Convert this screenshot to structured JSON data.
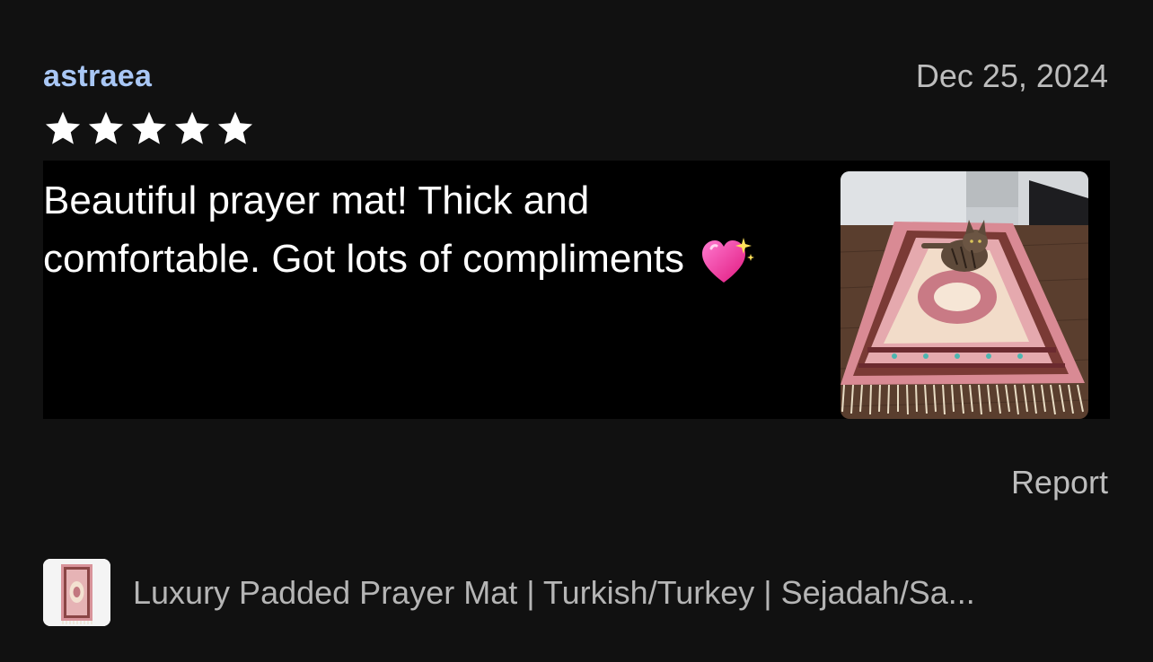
{
  "review": {
    "reviewer_name": "astraea",
    "date": "Dec 25, 2024",
    "rating": 5,
    "rating_max": 5,
    "text": "Beautiful prayer mat! Thick and comfortable. Got lots of compliments",
    "emoji_icon": "sparkling-heart-icon",
    "report_label": "Report"
  },
  "product": {
    "title": "Luxury Padded Prayer Mat | Turkish/Turkey | Sejadah/Sa..."
  },
  "colors": {
    "background": "#111111",
    "reviewer_name": "#a9c7f5",
    "muted_text": "#bdbdbd",
    "star": "#ffffff"
  }
}
